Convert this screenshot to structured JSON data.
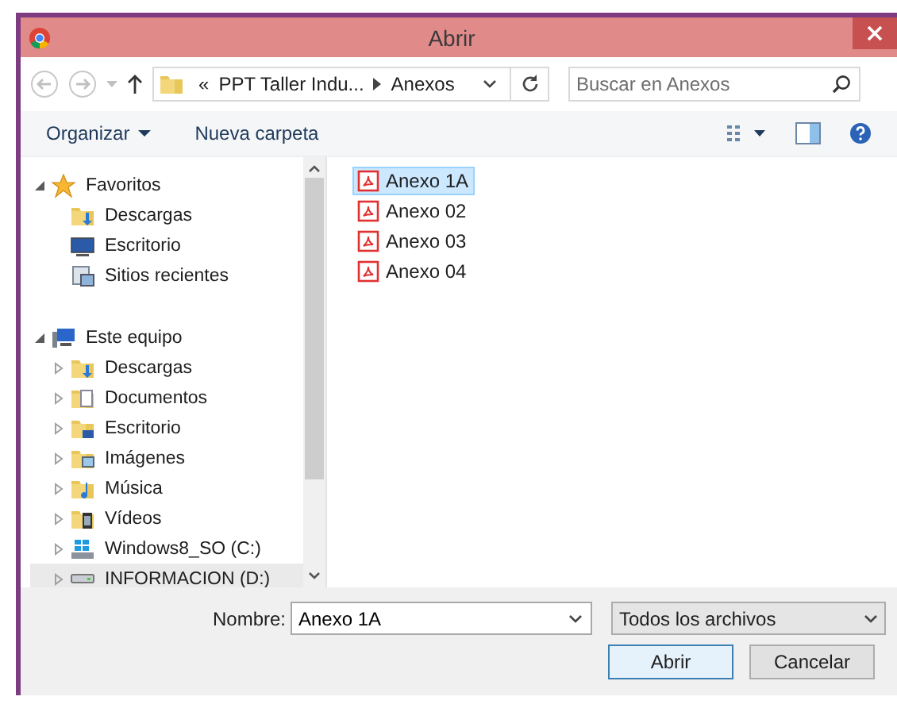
{
  "window": {
    "title": "Abrir"
  },
  "address": {
    "overflow": "«",
    "parts": [
      "PPT Taller Indu...",
      "Anexos"
    ]
  },
  "search": {
    "placeholder": "Buscar en Anexos"
  },
  "toolbar": {
    "organize": "Organizar",
    "new_folder": "Nueva carpeta"
  },
  "sidebar": {
    "items": [
      {
        "label": "Favoritos",
        "kind": "favorites",
        "expanded": true,
        "children": [
          {
            "label": "Descargas",
            "kind": "downloads",
            "highlighted": false
          },
          {
            "label": "Escritorio",
            "kind": "desktop",
            "highlighted": false
          },
          {
            "label": "Sitios recientes",
            "kind": "recent",
            "highlighted": false
          }
        ]
      },
      {
        "label": "Este equipo",
        "kind": "computer",
        "expanded": true,
        "children": [
          {
            "label": "Descargas",
            "kind": "downloads",
            "expanded": false,
            "highlighted": false
          },
          {
            "label": "Documentos",
            "kind": "documents",
            "expanded": false,
            "highlighted": false
          },
          {
            "label": "Escritorio",
            "kind": "desktop-folder",
            "expanded": false,
            "highlighted": false
          },
          {
            "label": "Imágenes",
            "kind": "pictures",
            "expanded": false,
            "highlighted": false
          },
          {
            "label": "Música",
            "kind": "music",
            "expanded": false,
            "highlighted": false
          },
          {
            "label": "Vídeos",
            "kind": "videos",
            "expanded": false,
            "highlighted": false
          },
          {
            "label": "Windows8_SO (C:)",
            "kind": "os-drive",
            "expanded": false,
            "highlighted": false
          },
          {
            "label": "INFORMACION (D:)",
            "kind": "drive",
            "expanded": false,
            "highlighted": true
          }
        ]
      }
    ]
  },
  "files": [
    {
      "name": "Anexo 1A",
      "selected": true
    },
    {
      "name": "Anexo 02",
      "selected": false
    },
    {
      "name": "Anexo 03",
      "selected": false
    },
    {
      "name": "Anexo 04",
      "selected": false
    }
  ],
  "footer": {
    "name_label": "Nombre:",
    "name_value": "Anexo 1A",
    "filter": "Todos los archivos",
    "buttons": [
      {
        "label": "Abrir",
        "kind": "default"
      },
      {
        "label": "Cancelar",
        "kind": "normal"
      }
    ]
  }
}
